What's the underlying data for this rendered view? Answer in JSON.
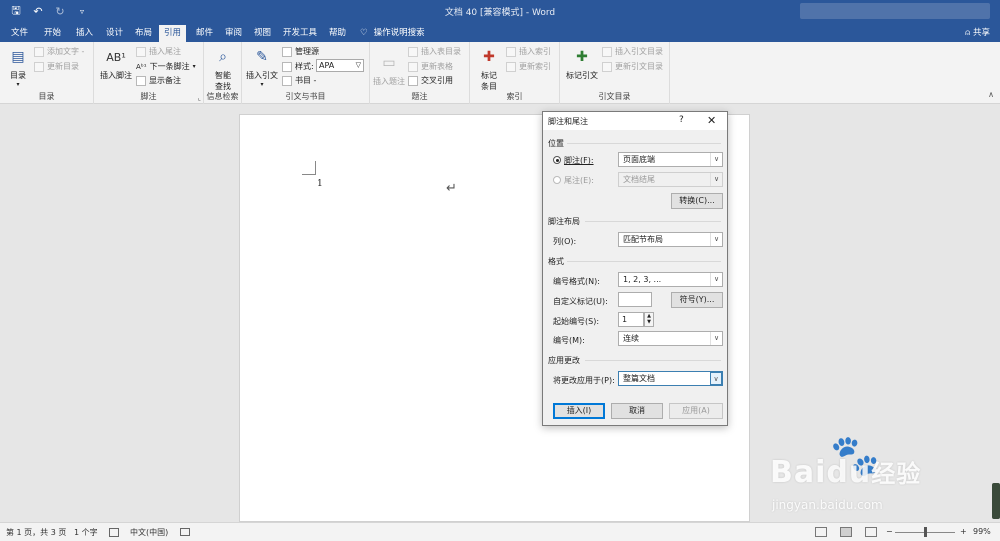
{
  "titlebar": {
    "title": "文档 40 [兼容模式] - Word",
    "qat": {
      "save_icon": "save-icon",
      "undo_icon": "undo-icon",
      "redo_icon": "redo-icon",
      "customize_icon": "customize-icon"
    }
  },
  "tabs": {
    "items": [
      "文件",
      "开始",
      "插入",
      "设计",
      "布局",
      "引用",
      "邮件",
      "审阅",
      "视图",
      "开发工具",
      "帮助"
    ],
    "active": "引用",
    "tell_me": "操作说明搜索",
    "share": "共享"
  },
  "ribbon": {
    "toc": {
      "big": "目录",
      "add_text": "添加文字 -",
      "update": "更新目录",
      "label": "目录"
    },
    "footnotes": {
      "insert_footnote": "插入脚注",
      "insert_endnote": "插入尾注",
      "next_footnote": "下一条脚注",
      "show_notes": "显示备注",
      "label": "脚注"
    },
    "research": {
      "smart_lookup": "智能\n查找",
      "smart_lookup_1": "智能",
      "smart_lookup_2": "查找",
      "label": "信息检索"
    },
    "citations": {
      "insert_citation": "插入引文",
      "manage_sources": "管理源",
      "style_label": "样式:",
      "style_value": "APA",
      "bibliography": "书目 -",
      "label": "引文与书目"
    },
    "captions": {
      "insert_caption": "插入题注",
      "insert_table_of_figures": "插入表目录",
      "update_table": "更新表格",
      "cross_reference": "交叉引用",
      "label": "题注"
    },
    "index": {
      "mark_entry_1": "标记",
      "mark_entry_2": "条目",
      "insert_index": "插入索引",
      "update_index": "更新索引",
      "label": "索引"
    },
    "toa": {
      "mark_citation": "标记引文",
      "insert_toa": "插入引文目录",
      "update_toa": "更新引文目录",
      "label": "引文目录"
    }
  },
  "document": {
    "footnote_number": "1",
    "paragraph_mark": "↵"
  },
  "dialog": {
    "title": "脚注和尾注",
    "help": "?",
    "close": "✕",
    "location": {
      "heading": "位置",
      "footnotes_label": "脚注(F):",
      "footnotes_value": "页面底端",
      "endnotes_label": "尾注(E):",
      "endnotes_value": "文档结尾",
      "convert": "转换(C)..."
    },
    "layout": {
      "heading": "脚注布局",
      "columns_label": "列(O):",
      "columns_value": "匹配节布局"
    },
    "format": {
      "heading": "格式",
      "number_format_label": "编号格式(N):",
      "number_format_value": "1, 2, 3, ...",
      "custom_mark_label": "自定义标记(U):",
      "custom_mark_value": "",
      "symbol": "符号(Y)...",
      "start_at_label": "起始编号(S):",
      "start_at_value": "1",
      "numbering_label": "编号(M):",
      "numbering_value": "连续"
    },
    "apply": {
      "heading": "应用更改",
      "apply_to_label": "将更改应用于(P):",
      "apply_to_value": "整篇文档"
    },
    "buttons": {
      "insert": "插入(I)",
      "cancel": "取消",
      "apply": "应用(A)"
    }
  },
  "status": {
    "page": "第 1 页，共 3 页",
    "words": "1 个字",
    "language": "中文(中国)",
    "zoom_minus": "−",
    "zoom_plus": "+",
    "zoom": "99%"
  },
  "watermark": {
    "brand": "Bai",
    "brand2": "经验",
    "url": "jingyan.baidu.com"
  }
}
